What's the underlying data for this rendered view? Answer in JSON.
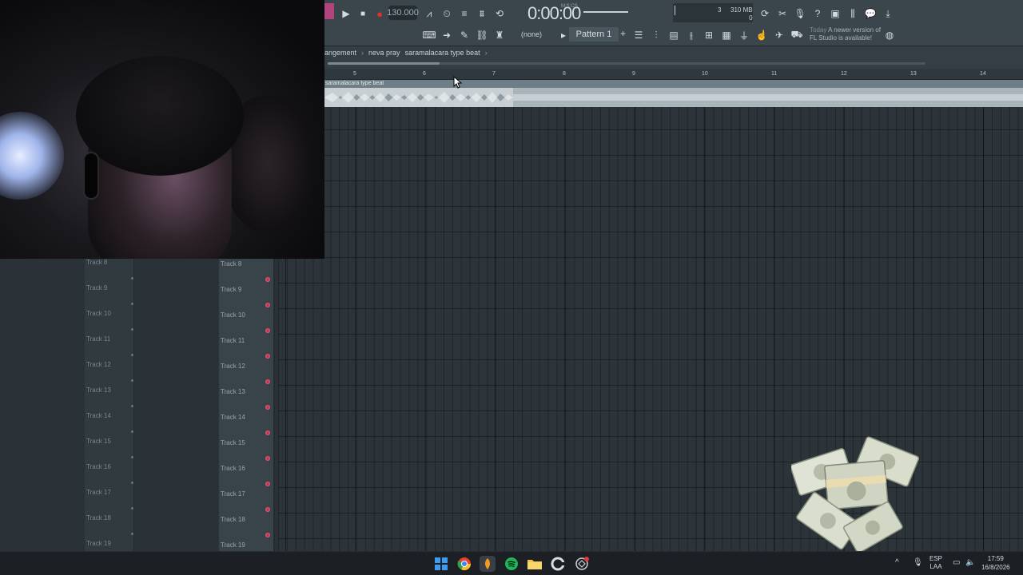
{
  "toolbar": {
    "tempo": "130.000",
    "time": "0:00:00",
    "time_unit": "M:S:CS",
    "cpu_poly": "3",
    "memory": "310 MB",
    "memory_sub": "0",
    "snap_label": "(none)",
    "pattern_label": "Pattern 1",
    "pattern_add": "+",
    "news_date": "Today",
    "news_text": "A newer version of FL Studio is available!"
  },
  "breadcrumb": [
    "angement",
    "neva pray",
    "saramalacara type beat"
  ],
  "ruler": [
    "5",
    "6",
    "7",
    "8",
    "9",
    "10",
    "11",
    "12",
    "13",
    "14"
  ],
  "clip": {
    "name": "saramalacara type beat"
  },
  "tracks": [
    "Track 8",
    "Track 9",
    "Track 10",
    "Track 11",
    "Track 12",
    "Track 13",
    "Track 14",
    "Track 15",
    "Track 16",
    "Track 17",
    "Track 18",
    "Track 19"
  ],
  "taskbar": {
    "lang_top": "ESP",
    "lang_bottom": "LAA",
    "time": "17:59",
    "date": "16/8/2026"
  },
  "colors": {
    "accent_record": "#e03030",
    "track_led": "#c43a56",
    "windows_blue": "#3b9cf0",
    "spotify_green": "#1db954"
  },
  "icons": [
    "play-icon",
    "stop-icon",
    "record-icon",
    "windows-start-icon",
    "chrome-icon",
    "fl-studio-icon",
    "spotify-icon",
    "file-explorer-icon",
    "ccleaner-icon",
    "app-icon",
    "wifi-icon",
    "volume-icon",
    "microphone-icon"
  ]
}
